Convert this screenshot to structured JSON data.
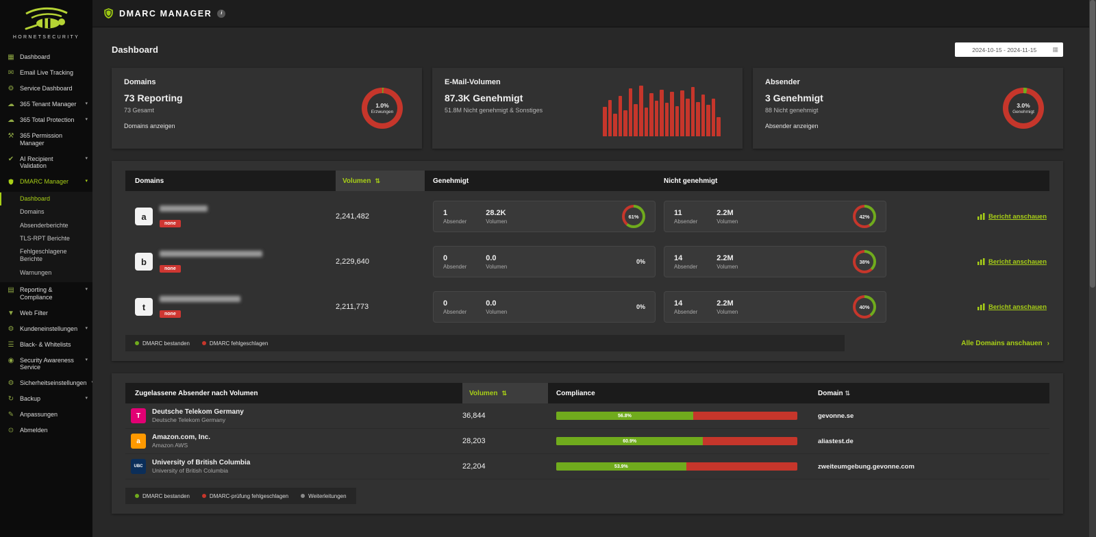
{
  "icons": {
    "chevron_down": "▾",
    "sort": "⇅",
    "info": "i",
    "calendar": "▦",
    "arrow_right": "›"
  },
  "brand": {
    "name": "HORNETSECURITY"
  },
  "topbar": {
    "title": "DMARC MANAGER"
  },
  "sidebar": {
    "items": [
      {
        "label": "Dashboard",
        "icon": "▦"
      },
      {
        "label": "Email Live Tracking",
        "icon": "✉"
      },
      {
        "label": "Service Dashboard",
        "icon": "⚙"
      },
      {
        "label": "365 Tenant Manager",
        "icon": "☁"
      },
      {
        "label": "365 Total Protection",
        "icon": "☁"
      },
      {
        "label": "365 Permission Manager",
        "icon": "⚒"
      },
      {
        "label": "AI Recipient Validation",
        "icon": "✔"
      },
      {
        "label": "DMARC Manager",
        "icon": "shield"
      },
      {
        "label": "Reporting & Compliance",
        "icon": "▤"
      },
      {
        "label": "Web Filter",
        "icon": "▼"
      },
      {
        "label": "Kundeneinstellungen",
        "icon": "⚙"
      },
      {
        "label": "Black- & Whitelists",
        "icon": "☰"
      },
      {
        "label": "Security Awareness Service",
        "icon": "◉"
      },
      {
        "label": "Sicherheitseinstellungen",
        "icon": "⚙"
      },
      {
        "label": "Backup",
        "icon": "↻"
      },
      {
        "label": "Anpassungen",
        "icon": "✎"
      },
      {
        "label": "Abmelden",
        "icon": "⊙"
      }
    ],
    "dmarc_children": [
      {
        "label": "Dashboard"
      },
      {
        "label": "Domains"
      },
      {
        "label": "Absenderberichte"
      },
      {
        "label": "TLS-RPT Berichte"
      },
      {
        "label": "Fehlgeschlagene Berichte"
      },
      {
        "label": "Warnungen"
      }
    ]
  },
  "page": {
    "title": "Dashboard",
    "date_range": "2024-10-15 - 2024-11-15"
  },
  "summary": {
    "domains": {
      "title": "Domains",
      "value": "73 Reporting",
      "sub": "73 Gesamt",
      "link": "Domains anzeigen",
      "donut_pct": "1.0%",
      "donut_label": "Erzwungen",
      "donut_value": 1
    },
    "volume": {
      "title": "E-Mail-Volumen",
      "value": "87.3K Genehmigt",
      "sub": "51.8M Nicht genehmigt & Sonstiges"
    },
    "senders": {
      "title": "Absender",
      "value": "3 Genehmigt",
      "sub": "88 Nicht genehmigt",
      "link": "Absender anzeigen",
      "donut_pct": "3.0%",
      "donut_label": "Genehmigt",
      "donut_value": 3
    }
  },
  "chart_data": {
    "type": "bar",
    "title": "",
    "xlabel": "",
    "ylabel": "",
    "categories": [],
    "values": [
      58,
      72,
      44,
      80,
      52,
      95,
      63,
      100,
      57,
      85,
      70,
      92,
      66,
      88,
      60,
      90,
      75,
      97,
      68,
      83,
      62,
      74,
      38
    ],
    "ylim": [
      0,
      100
    ],
    "color": "#c6362b",
    "note": "unlabeled red volume sparkline; heights estimated as % of tallest bar"
  },
  "domains_table": {
    "col_domains": "Domains",
    "col_volume": "Volumen",
    "col_approved": "Genehmigt",
    "col_not_approved": "Nicht genehmigt",
    "absender_label": "Absender",
    "volumen_label": "Volumen",
    "rows": [
      {
        "avatar": "a",
        "badge": "none",
        "volume": "2,241,482",
        "approved": {
          "senders": "1",
          "volume": "28.2K",
          "pct": "61%",
          "pct_value": 61
        },
        "not_approved": {
          "senders": "11",
          "volume": "2.2M",
          "pct": "42%",
          "pct_value": 42
        },
        "link": "Bericht anschauen"
      },
      {
        "avatar": "b",
        "badge": "none",
        "volume": "2,229,640",
        "approved": {
          "senders": "0",
          "volume": "0.0",
          "pct": "0%",
          "pct_value": 0
        },
        "not_approved": {
          "senders": "14",
          "volume": "2.2M",
          "pct": "38%",
          "pct_value": 38
        },
        "link": "Bericht anschauen"
      },
      {
        "avatar": "t",
        "badge": "none",
        "volume": "2,211,773",
        "approved": {
          "senders": "0",
          "volume": "0.0",
          "pct": "0%",
          "pct_value": 0
        },
        "not_approved": {
          "senders": "14",
          "volume": "2.2M",
          "pct": "40%",
          "pct_value": 40
        },
        "link": "Bericht anschauen"
      }
    ],
    "legend": [
      {
        "label": "DMARC bestanden",
        "color": "#70ab1d"
      },
      {
        "label": "DMARC fehlgeschlagen",
        "color": "#c6362b"
      }
    ],
    "footer_link": "Alle Domains anschauen"
  },
  "senders_table": {
    "title": "Zugelassene Absender nach Volumen",
    "col_volume": "Volumen",
    "col_compliance": "Compliance",
    "col_domain": "Domain",
    "rows": [
      {
        "logo_text": "T",
        "logo_bg": "#e20074",
        "name": "Deutsche Telekom Germany",
        "subname": "Deutsche Telekom Germany",
        "volume": "36,844",
        "compliance_label": "56.8%",
        "compliance_value": 56.8,
        "domain": "gevonne.se"
      },
      {
        "logo_text": "a",
        "logo_bg": "#ff9900",
        "name": "Amazon.com, Inc.",
        "subname": "Amazon AWS",
        "volume": "28,203",
        "compliance_label": "60.9%",
        "compliance_value": 60.9,
        "domain": "aliastest.de"
      },
      {
        "logo_text": "UBC",
        "logo_bg": "#0b2e59",
        "name": "University of British Columbia",
        "subname": "University of British Columbia",
        "volume": "22,204",
        "compliance_label": "53.9%",
        "compliance_value": 53.9,
        "domain": "zweiteumgebung.gevonne.com"
      }
    ],
    "legend": [
      {
        "label": "DMARC bestanden",
        "color": "#70ab1d"
      },
      {
        "label": "DMARC-prüfung fehlgeschlagen",
        "color": "#c6362b"
      },
      {
        "label": "Weiterleitungen",
        "color": "#8a8a8a"
      }
    ]
  }
}
